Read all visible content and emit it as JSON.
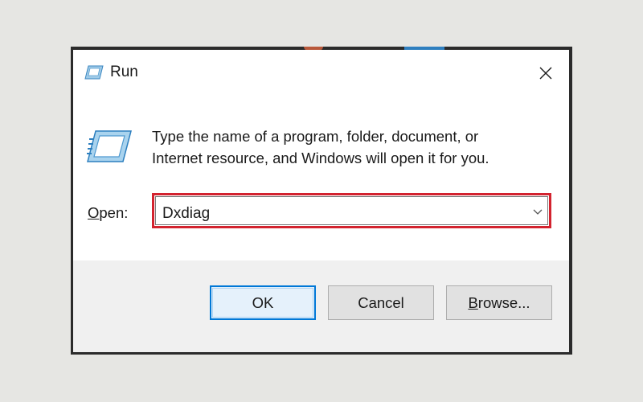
{
  "window": {
    "title": "Run",
    "close_icon": "close-icon",
    "title_icon": "run-icon"
  },
  "content": {
    "description_line1": "Type the name of a program, folder, document, or",
    "description_line2": "Internet resource, and Windows will open it for you.",
    "open_label_accel": "O",
    "open_label_rest": "pen:",
    "open_value": "Dxdiag",
    "highlight_color": "#d3232f"
  },
  "buttons": {
    "ok_label": "OK",
    "cancel_label": "Cancel",
    "browse_accel": "B",
    "browse_rest": "rowse..."
  },
  "colors": {
    "accent": "#0078d7",
    "background": "#f0f0f0"
  }
}
